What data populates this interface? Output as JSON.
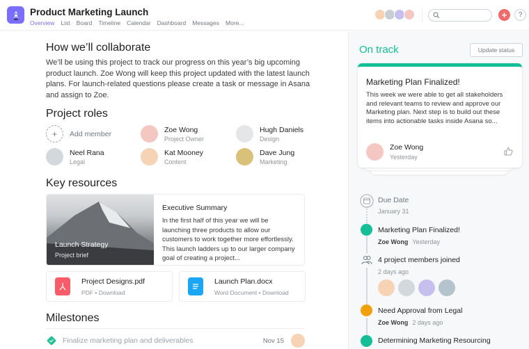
{
  "header": {
    "project_title": "Product Marketing Launch",
    "tabs": [
      {
        "label": "Overview",
        "active": true
      },
      {
        "label": "List",
        "active": false
      },
      {
        "label": "Board",
        "active": false
      },
      {
        "label": "Timeline",
        "active": false
      },
      {
        "label": "Calendar",
        "active": false
      },
      {
        "label": "Dashboard",
        "active": false
      },
      {
        "label": "Messages",
        "active": false
      },
      {
        "label": "More...",
        "active": false
      }
    ],
    "search_placeholder": "",
    "add_label": "+",
    "help_label": "?",
    "member_avatar_colors": [
      "#f6d3b5",
      "#c9ced3",
      "#c7c0ef",
      "#f4c7c3"
    ],
    "accent_color": "#796eff"
  },
  "collaborate": {
    "heading": "How we’ll collaborate",
    "body": "We’ll be using this project to track our progress on this year’s big upcoming product launch. Zoe Wong will keep this project updated with the latest launch plans. For launch-related questions please create a task or message in Asana and assign to Zoe."
  },
  "roles": {
    "heading": "Project roles",
    "add_member_label": "Add member",
    "members": [
      {
        "name": "Zoe Wong",
        "role": "Project Owner",
        "color": "#f4c7c3"
      },
      {
        "name": "Hugh Daniels",
        "role": "Design",
        "color": "#e4e6e8"
      },
      {
        "name": "Neel Rana",
        "role": "Legal",
        "color": "#d3d8dc"
      },
      {
        "name": "Kat Mooney",
        "role": "Content",
        "color": "#f6d3b5"
      },
      {
        "name": "Dave Jung",
        "role": "Marketing",
        "color": "#d9c17a"
      }
    ]
  },
  "resources": {
    "heading": "Key resources",
    "brief": {
      "image_title": "Launch Strategy",
      "image_subtitle": "Project brief",
      "title": "Executive Summary",
      "body": "In the first half of this year we will be launching three products to allow our customers to work together more effortlessly. This launch ladders up to our larger company goal of creating a project..."
    },
    "files": [
      {
        "name": "Project Designs.pdf",
        "type": "PDF",
        "action": "Download",
        "icon": "pdf-icon",
        "color": "#f95c69"
      },
      {
        "name": "Launch Plan.docx",
        "type": "Word Document",
        "action": "Download",
        "icon": "doc-icon",
        "color": "#1aa5f5"
      }
    ]
  },
  "milestones": {
    "heading": "Milestones",
    "items": [
      {
        "title": "Finalize marketing plan and deliverables",
        "date": "Nov 15",
        "done": true
      }
    ]
  },
  "status": {
    "label": "On track",
    "color": "#14bf97",
    "update_button": "Update status",
    "card": {
      "title": "Marketing Plan Finalized!",
      "body": "This week we were able to get all stakeholders and relevant teams to review and approve our Marketing plan. Next step is to build out these items into actionable tasks inside Asana so...",
      "author": "Zoe Wong",
      "date": "Yesterday"
    }
  },
  "timeline": {
    "due": {
      "title": "Due Date",
      "date": "January 31"
    },
    "items": [
      {
        "title": "Marketing Plan Finalized!",
        "author": "Zoe Wong",
        "time": "Yesterday",
        "color": "#14bf97"
      },
      {
        "title": "4 project members joined",
        "time": "2 days ago",
        "avatars": [
          "#f6d3b5",
          "#d3d8dc",
          "#c7c0ef",
          "#b5c4cc"
        ]
      },
      {
        "title": "Need Approval from Legal",
        "author": "Zoe Wong",
        "time": "2 days ago",
        "color": "#f1a10d"
      },
      {
        "title": "Determining Marketing Resourcing",
        "color": "#14bf97"
      }
    ]
  }
}
